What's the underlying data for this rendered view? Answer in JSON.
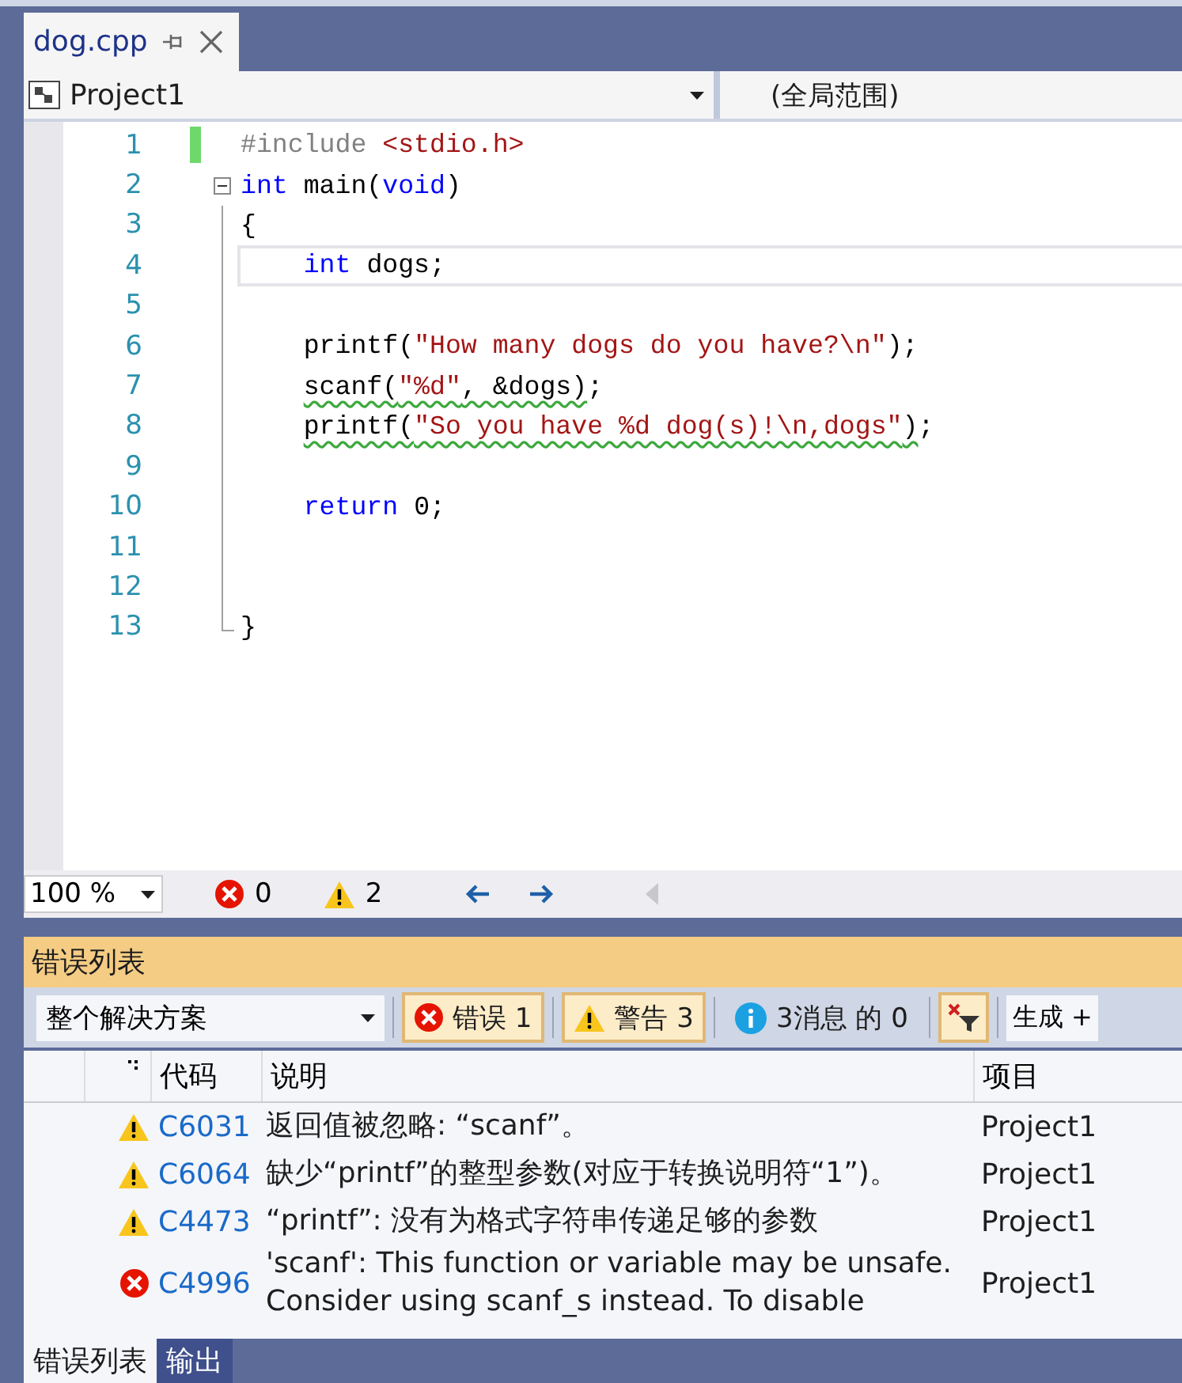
{
  "document_tab": {
    "title": "dog.cpp",
    "selected": true
  },
  "navigation_bar": {
    "project": "Project1",
    "scope": "(全局范围)"
  },
  "editor": {
    "lines": [
      {
        "number": "1",
        "kind": "plain",
        "changed": true,
        "current": false,
        "tokens": [
          {
            "kind": "pre",
            "text": "#include "
          },
          {
            "kind": "str",
            "text": "<stdio.h>"
          }
        ]
      },
      {
        "number": "2",
        "kind": "start",
        "changed": false,
        "current": false,
        "tokens": [
          {
            "kind": "kw",
            "text": "int"
          },
          {
            "kind": "plain",
            "text": " main("
          },
          {
            "kind": "kw",
            "text": "void"
          },
          {
            "kind": "plain",
            "text": ")"
          }
        ]
      },
      {
        "number": "3",
        "kind": "body",
        "changed": false,
        "current": false,
        "tokens": [
          {
            "kind": "plain",
            "text": "{"
          }
        ]
      },
      {
        "number": "4",
        "kind": "body",
        "changed": false,
        "current": true,
        "tokens": [
          {
            "kind": "kw",
            "text": "    int"
          },
          {
            "kind": "plain",
            "text": " dogs;"
          }
        ]
      },
      {
        "number": "5",
        "kind": "body",
        "changed": false,
        "current": false
      },
      {
        "number": "6",
        "kind": "body",
        "changed": false,
        "current": false,
        "tokens": [
          {
            "kind": "plain",
            "text": "    printf("
          },
          {
            "kind": "str",
            "text": "\"How many dogs do you have?\\n\""
          },
          {
            "kind": "plain",
            "text": ");"
          }
        ]
      },
      {
        "number": "7",
        "kind": "body",
        "changed": false,
        "current": false,
        "tokens": [
          {
            "kind": "plain",
            "text": "    scanf(",
            "squiggle": true
          },
          {
            "kind": "str",
            "text": "\"%d\"",
            "squiggle": true
          },
          {
            "kind": "plain",
            "text": ", &dogs)",
            "squiggle": true
          },
          {
            "kind": "plain",
            "text": ";",
            "squiggle": false
          }
        ]
      },
      {
        "number": "8",
        "kind": "body",
        "changed": false,
        "current": false,
        "tokens": [
          {
            "kind": "plain",
            "text": "    printf(",
            "squiggle": true
          },
          {
            "kind": "str",
            "text": "\"So you have %d dog(s)!\\n,dogs\"",
            "squiggle": true
          },
          {
            "kind": "plain",
            "text": ")",
            "squiggle": true
          },
          {
            "kind": "plain",
            "text": ";",
            "squiggle": false
          }
        ]
      },
      {
        "number": "9",
        "kind": "body",
        "changed": false,
        "current": false
      },
      {
        "number": "10",
        "kind": "body",
        "changed": false,
        "current": false,
        "tokens": [
          {
            "kind": "kw",
            "text": "    return"
          },
          {
            "kind": "plain",
            "text": " 0;"
          }
        ]
      },
      {
        "number": "11",
        "kind": "body",
        "changed": false,
        "current": false
      },
      {
        "number": "12",
        "kind": "body",
        "changed": false,
        "current": false
      },
      {
        "number": "13",
        "kind": "end",
        "changed": false,
        "current": false,
        "tokens": [
          {
            "kind": "plain",
            "text": "}"
          }
        ]
      }
    ]
  },
  "editor_status": {
    "zoom": "100 %",
    "errors": "0",
    "warnings": "2"
  },
  "error_list": {
    "title": "错误列表",
    "scope": "整个解决方案",
    "filters": [
      {
        "kind": "error",
        "label": "错误 1",
        "selected": true
      },
      {
        "kind": "warning",
        "label": "警告 3",
        "selected": true
      },
      {
        "kind": "info",
        "label": "3消息 的 0",
        "selected": false
      }
    ],
    "clear_filter_selected": true,
    "build_dropdown": "生成 +",
    "columns": [
      "代码",
      "说明",
      "项目"
    ],
    "rows": [
      {
        "kind": "warning",
        "code": "C6031",
        "description": "返回值被忽略: “scanf”。",
        "project": "Project1"
      },
      {
        "kind": "warning",
        "code": "C6064",
        "description": "缺少“printf”的整型参数(对应于转换说明符“1”)。",
        "project": "Project1"
      },
      {
        "kind": "warning",
        "code": "C4473",
        "description": " “printf”: 没有为格式字符串传递足够的参数",
        "project": "Project1"
      },
      {
        "kind": "error",
        "code": "C4996",
        "description": " 'scanf': This function or variable may be unsafe.\nConsider using scanf_s instead. To disable",
        "project": "Project1"
      }
    ]
  },
  "bottom_tabs": [
    {
      "label": "错误列表",
      "selected": true
    },
    {
      "label": "输出",
      "selected": false
    }
  ]
}
